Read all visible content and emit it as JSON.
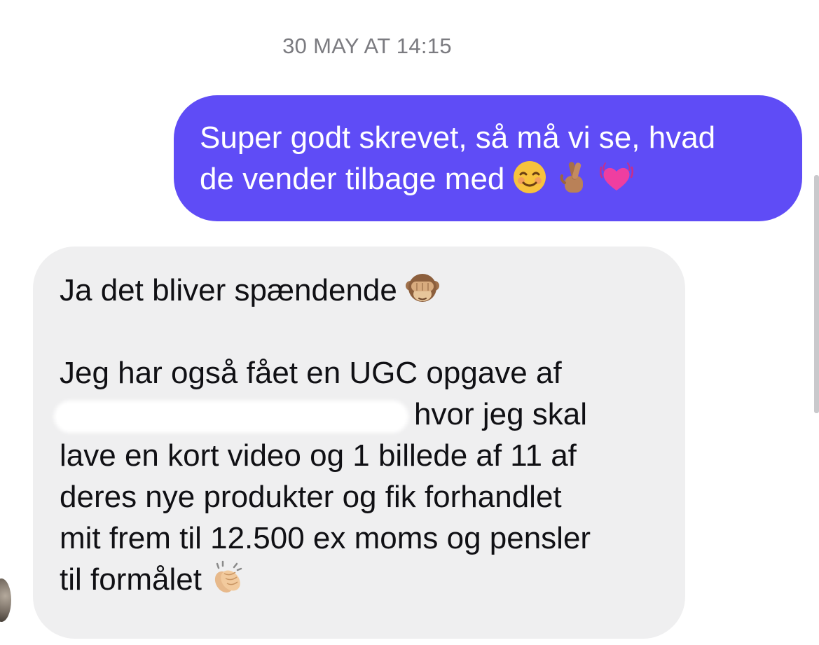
{
  "conversation": {
    "timestamp": "30 MAY AT 14:15",
    "messages": [
      {
        "direction": "outgoing",
        "bubble_color": "#5f4cf6",
        "lines": [
          "Super godt skrevet, så må vi se, hvad",
          "de vender tilbage med"
        ],
        "emojis": [
          "smiling-face-icon",
          "crossed-fingers-icon",
          "beating-heart-icon"
        ]
      },
      {
        "direction": "incoming",
        "bubble_color": "#efeff0",
        "lines": [
          "Ja det bliver spændende",
          "",
          "Jeg har også fået en UGC opgave af",
          "hvor jeg skal",
          "lave en kort video og 1 billede af 11 af",
          "deres nye produkter og fik forhandlet",
          "mit frem til 12.500 ex moms og pensler",
          "til formålet"
        ],
        "emojis": [
          "see-no-evil-monkey-icon",
          "clapping-hands-icon"
        ]
      }
    ]
  }
}
